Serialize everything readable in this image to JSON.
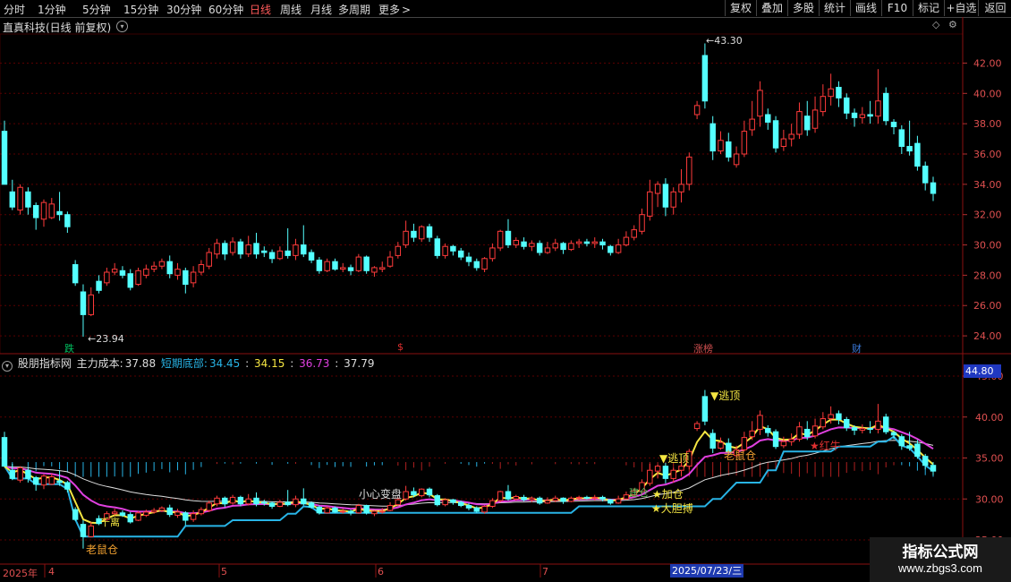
{
  "toolbar": {
    "timeframes": [
      "分时",
      "1分钟",
      "5分钟",
      "15分钟",
      "30分钟",
      "60分钟",
      "日线",
      "周线",
      "月线",
      "多周期",
      "更多"
    ],
    "active": "日线",
    "right_buttons": [
      "复权",
      "叠加",
      "多股",
      "统计",
      "画线",
      "F10",
      "标记",
      "+自选",
      "返回"
    ]
  },
  "header": {
    "stock_title": "直真科技(日线 前复权)"
  },
  "price_axis": {
    "labels": [
      "42.00",
      "40.00",
      "38.00",
      "36.00",
      "34.00",
      "32.00",
      "30.00",
      "28.00",
      "26.00",
      "24.00"
    ],
    "min": 23.0,
    "max": 43.8
  },
  "annotations": {
    "high": "43.30",
    "low": "23.94"
  },
  "event_markers": [
    {
      "label": "跌",
      "color": "#00c060"
    },
    {
      "label": "$",
      "color": "#e03030"
    },
    {
      "label": "涨榜",
      "color": "#d05050"
    },
    {
      "label": "财",
      "color": "#3a7adc"
    }
  ],
  "lower_panel": {
    "title": "股朋指标网",
    "main_cost_label": "主力成本:",
    "main_cost_value": "37.88",
    "short_bottom_label": "短期底部:",
    "short_bottom_value": "34.45",
    "value_yellow": "34.15",
    "value_magenta": "36.73",
    "value_white": "37.79",
    "axis_labels": [
      "45.00",
      "40.00",
      "35.00",
      "30.00",
      "25.00"
    ],
    "current_value_box": "44.80",
    "signals": {
      "escape_top": "逃顶",
      "old_mouse_1": "老鼠仓",
      "old_mouse_2": "老鼠仓",
      "caution": "小心变盘",
      "add_pos": "加仓",
      "bold_bet": "大胆搏",
      "red_bull": "红牛",
      "jiancang": "建仓",
      "ganqu": "千离",
      "escape_top_2": "逃顶"
    }
  },
  "x_axis": {
    "year": "2025年",
    "months": [
      "4",
      "5",
      "6",
      "7"
    ],
    "highlight_date": "2025/07/23/三"
  },
  "watermark": {
    "line1": "指标公式网",
    "line2": "www.zbgs3.com"
  },
  "chart_data": {
    "type": "candlestick",
    "ylim": [
      23.0,
      43.8
    ],
    "candles": [
      [
        37.5,
        34.0,
        38.2,
        34.0
      ],
      [
        33.5,
        32.5,
        34.3,
        32.3
      ],
      [
        32.3,
        33.8,
        34.0,
        32.0
      ],
      [
        33.5,
        32.5,
        33.8,
        32.0
      ],
      [
        32.6,
        31.8,
        32.8,
        31.0
      ],
      [
        31.7,
        32.8,
        33.0,
        31.2
      ],
      [
        31.8,
        32.7,
        33.1,
        31.7
      ],
      [
        32.2,
        32.0,
        33.5,
        31.6
      ],
      [
        32.0,
        31.2,
        32.2,
        30.8
      ],
      [
        28.7,
        27.5,
        29.0,
        27.3
      ],
      [
        26.9,
        25.4,
        27.4,
        23.94
      ],
      [
        25.4,
        26.7,
        27.2,
        25.3
      ],
      [
        27.6,
        27.0,
        28.0,
        26.8
      ],
      [
        27.5,
        28.2,
        28.5,
        27.3
      ],
      [
        28.2,
        28.4,
        28.8,
        28.0
      ],
      [
        28.3,
        28.0,
        28.6,
        27.8
      ],
      [
        28.1,
        27.2,
        28.4,
        27.0
      ],
      [
        27.4,
        28.3,
        28.5,
        27.3
      ],
      [
        28.0,
        28.4,
        28.7,
        27.8
      ],
      [
        28.4,
        28.6,
        28.9,
        28.2
      ],
      [
        28.6,
        28.9,
        29.1,
        28.4
      ],
      [
        28.9,
        28.1,
        29.3,
        27.8
      ],
      [
        28.0,
        28.4,
        28.8,
        27.7
      ],
      [
        28.3,
        27.4,
        28.5,
        26.8
      ],
      [
        27.5,
        28.2,
        28.6,
        27.2
      ],
      [
        28.2,
        28.7,
        29.0,
        28.0
      ],
      [
        28.6,
        29.5,
        29.8,
        28.4
      ],
      [
        29.4,
        30.1,
        30.4,
        29.1
      ],
      [
        30.1,
        29.4,
        30.3,
        29.0
      ],
      [
        29.5,
        30.2,
        30.5,
        29.3
      ],
      [
        30.2,
        29.4,
        30.4,
        29.1
      ],
      [
        29.4,
        30.0,
        30.6,
        29.2
      ],
      [
        30.1,
        29.4,
        30.8,
        29.1
      ],
      [
        29.6,
        29.5,
        29.9,
        29.2
      ],
      [
        29.5,
        29.1,
        29.7,
        28.8
      ],
      [
        29.1,
        29.6,
        29.9,
        29.0
      ],
      [
        29.6,
        29.3,
        31.1,
        29.1
      ],
      [
        29.3,
        30.0,
        30.4,
        29.0
      ],
      [
        30.0,
        29.4,
        31.3,
        29.2
      ],
      [
        29.5,
        29.0,
        29.7,
        28.8
      ],
      [
        29.0,
        28.3,
        29.2,
        28.1
      ],
      [
        28.3,
        28.9,
        29.1,
        28.2
      ],
      [
        28.9,
        28.4,
        29.1,
        28.3
      ],
      [
        28.4,
        28.5,
        28.8,
        28.2
      ],
      [
        28.5,
        28.3,
        28.7,
        28.0
      ],
      [
        28.3,
        29.2,
        29.4,
        28.2
      ],
      [
        29.2,
        28.3,
        29.3,
        28.1
      ],
      [
        28.2,
        28.5,
        28.6,
        27.9
      ],
      [
        28.4,
        28.5,
        28.9,
        28.2
      ],
      [
        28.6,
        29.2,
        29.6,
        28.5
      ],
      [
        29.3,
        29.9,
        30.2,
        29.1
      ],
      [
        30.0,
        30.9,
        31.6,
        29.8
      ],
      [
        30.9,
        30.5,
        31.4,
        30.2
      ],
      [
        30.4,
        31.2,
        31.3,
        30.2
      ],
      [
        31.2,
        30.5,
        31.4,
        30.2
      ],
      [
        30.4,
        29.3,
        30.6,
        29.1
      ],
      [
        29.3,
        29.9,
        30.1,
        29.1
      ],
      [
        29.9,
        29.6,
        30.0,
        29.3
      ],
      [
        29.6,
        29.2,
        29.8,
        29.0
      ],
      [
        29.2,
        28.9,
        29.5,
        28.6
      ],
      [
        28.9,
        28.5,
        29.1,
        28.3
      ],
      [
        28.4,
        29.1,
        29.2,
        28.2
      ],
      [
        29.1,
        29.8,
        30.1,
        28.9
      ],
      [
        29.8,
        30.9,
        31.0,
        29.6
      ],
      [
        30.9,
        30.0,
        31.7,
        29.8
      ],
      [
        30.0,
        30.3,
        30.5,
        29.8
      ],
      [
        30.2,
        29.9,
        30.5,
        29.7
      ],
      [
        29.9,
        30.1,
        30.3,
        29.6
      ],
      [
        30.1,
        29.5,
        30.3,
        29.3
      ],
      [
        29.5,
        29.8,
        30.2,
        29.4
      ],
      [
        29.8,
        30.1,
        30.4,
        29.6
      ],
      [
        30.1,
        29.7,
        30.2,
        29.4
      ],
      [
        29.7,
        30.1,
        30.3,
        29.6
      ],
      [
        30.1,
        30.2,
        30.4,
        29.8
      ],
      [
        30.2,
        30.1,
        30.4,
        29.9
      ],
      [
        30.1,
        30.2,
        30.5,
        29.8
      ],
      [
        30.2,
        30.0,
        30.4,
        29.7
      ],
      [
        29.9,
        29.5,
        30.0,
        29.3
      ],
      [
        29.5,
        30.0,
        30.4,
        29.4
      ],
      [
        30.0,
        30.5,
        30.9,
        29.9
      ],
      [
        30.5,
        31.0,
        31.3,
        30.3
      ],
      [
        30.9,
        32.0,
        32.4,
        30.7
      ],
      [
        31.9,
        33.5,
        34.3,
        31.6
      ],
      [
        33.4,
        34.0,
        34.2,
        32.5
      ],
      [
        34.0,
        32.5,
        34.4,
        31.9
      ],
      [
        32.5,
        33.5,
        33.8,
        32.0
      ],
      [
        33.5,
        34.0,
        35.0,
        32.8
      ],
      [
        34.0,
        35.8,
        36.1,
        33.6
      ],
      [
        38.6,
        39.2,
        39.5,
        38.3
      ],
      [
        42.5,
        39.5,
        43.3,
        39.0
      ],
      [
        38.0,
        36.2,
        38.5,
        35.6
      ],
      [
        36.2,
        36.9,
        37.5,
        36.0
      ],
      [
        36.8,
        35.8,
        37.4,
        35.5
      ],
      [
        35.3,
        36.0,
        36.5,
        35.1
      ],
      [
        36.0,
        37.5,
        38.2,
        35.8
      ],
      [
        37.6,
        38.3,
        39.5,
        37.2
      ],
      [
        38.5,
        40.2,
        40.8,
        37.8
      ],
      [
        38.6,
        38.1,
        39.0,
        37.6
      ],
      [
        38.2,
        36.4,
        38.5,
        36.1
      ],
      [
        36.5,
        37.0,
        37.6,
        36.2
      ],
      [
        37.0,
        37.3,
        38.0,
        36.5
      ],
      [
        37.3,
        38.8,
        39.4,
        37.0
      ],
      [
        38.5,
        37.6,
        39.5,
        37.2
      ],
      [
        37.7,
        38.9,
        39.8,
        37.4
      ],
      [
        38.8,
        39.8,
        40.6,
        38.5
      ],
      [
        39.8,
        40.3,
        41.3,
        39.2
      ],
      [
        40.4,
        39.7,
        40.8,
        39.1
      ],
      [
        39.7,
        38.7,
        40.0,
        38.3
      ],
      [
        38.7,
        38.4,
        39.0,
        37.8
      ],
      [
        38.4,
        38.6,
        39.1,
        38.0
      ],
      [
        38.6,
        38.5,
        39.5,
        38.0
      ],
      [
        38.5,
        39.5,
        41.6,
        38.0
      ],
      [
        40.0,
        38.2,
        40.4,
        37.9
      ],
      [
        38.1,
        37.8,
        38.3,
        37.3
      ],
      [
        37.6,
        36.5,
        37.9,
        36.0
      ],
      [
        36.5,
        36.2,
        38.2,
        35.9
      ],
      [
        36.7,
        35.2,
        37.2,
        34.9
      ],
      [
        35.2,
        34.1,
        35.5,
        33.6
      ],
      [
        34.1,
        33.4,
        34.5,
        32.9
      ]
    ]
  }
}
